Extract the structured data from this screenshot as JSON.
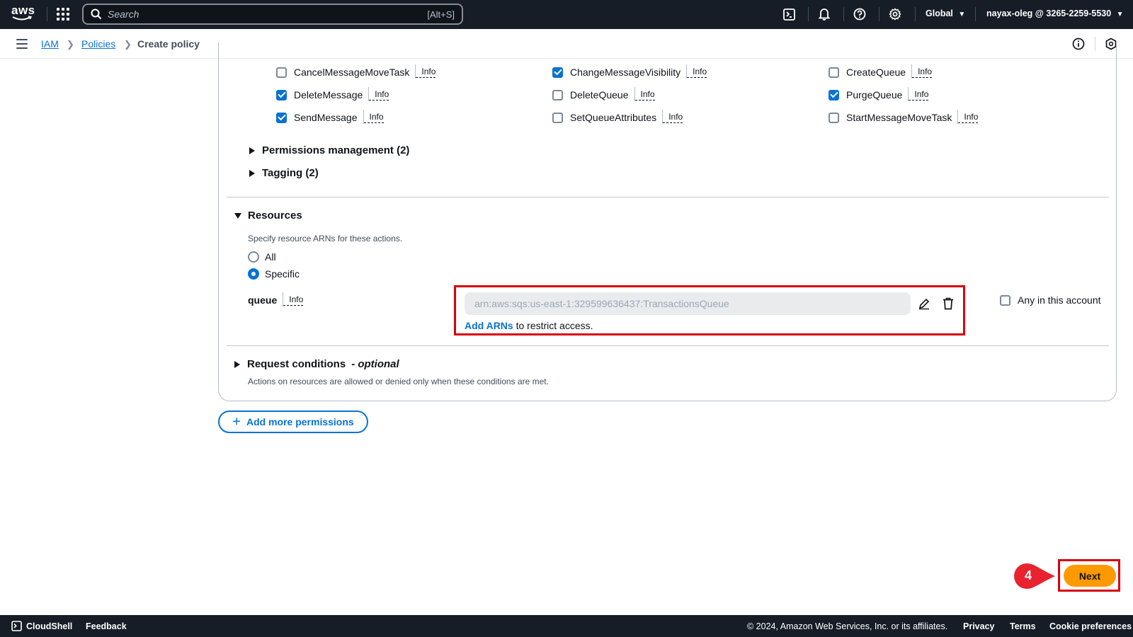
{
  "topnav": {
    "logo_text": "aws",
    "search_placeholder": "Search",
    "search_shortcut": "[Alt+S]",
    "region": "Global",
    "account": "nayax-oleg @ 3265-2259-5530"
  },
  "breadcrumb": {
    "items": [
      "IAM",
      "Policies",
      "Create policy"
    ]
  },
  "actions": {
    "info_label": "Info",
    "items": [
      {
        "label": "CancelMessageMoveTask",
        "checked": false
      },
      {
        "label": "ChangeMessageVisibility",
        "checked": true
      },
      {
        "label": "CreateQueue",
        "checked": false
      },
      {
        "label": "DeleteMessage",
        "checked": true
      },
      {
        "label": "DeleteQueue",
        "checked": false
      },
      {
        "label": "PurgeQueue",
        "checked": true
      },
      {
        "label": "SendMessage",
        "checked": true
      },
      {
        "label": "SetQueueAttributes",
        "checked": false
      },
      {
        "label": "StartMessageMoveTask",
        "checked": false
      }
    ],
    "groups": [
      "Permissions management (2)",
      "Tagging (2)"
    ]
  },
  "resources": {
    "title": "Resources",
    "description": "Specify resource ARNs for these actions.",
    "options": [
      {
        "label": "All",
        "selected": false
      },
      {
        "label": "Specific",
        "selected": true
      }
    ],
    "queue_label": "queue",
    "queue_info": "Info",
    "arn_value": "arn:aws:sqs:us-east-1:329599636437:TransactionsQueue",
    "add_arns_link": "Add ARNs",
    "add_arns_rest": " to restrict access.",
    "any_in_account": "Any in this account"
  },
  "request_conditions": {
    "title": "Request conditions",
    "optional": "- optional",
    "description": "Actions on resources are allowed or denied only when these conditions are met."
  },
  "add_more_permissions": "Add more permissions",
  "next_button": "Next",
  "step_badge": "4",
  "footer": {
    "cloudshell": "CloudShell",
    "feedback": "Feedback",
    "copyright": "© 2024, Amazon Web Services, Inc. or its affiliates.",
    "privacy": "Privacy",
    "terms": "Terms",
    "cookies": "Cookie preferences"
  },
  "colors": {
    "nav_bg": "#161d26",
    "link": "#0972d3",
    "primary_button": "#ff9900",
    "highlight": "#d80011",
    "badge": "#e8232f"
  }
}
